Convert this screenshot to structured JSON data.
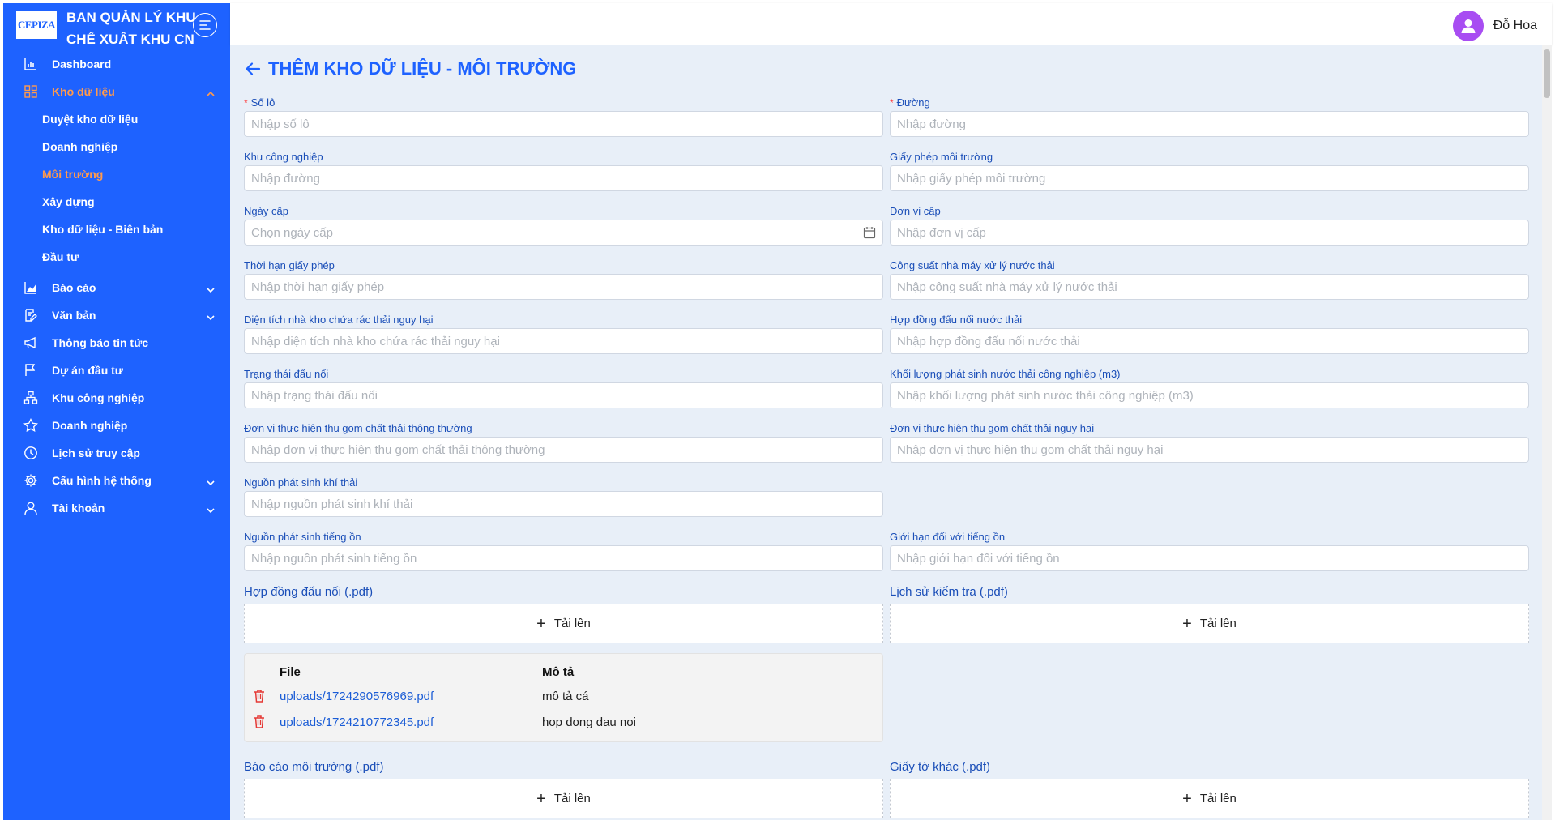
{
  "sidebar": {
    "brand_line1": "BAN QUẢN LÝ KHU",
    "brand_line2": "CHẾ XUẤT KHU CN",
    "logo_text": "CEPIZA",
    "items": [
      {
        "label": "Dashboard",
        "icon": "bar-chart-icon"
      },
      {
        "label": "Kho dữ liệu",
        "icon": "grid-icon",
        "active": true,
        "expanded": true
      },
      {
        "label": "Báo cáo",
        "icon": "line-chart-icon"
      },
      {
        "label": "Văn bản",
        "icon": "document-edit-icon"
      },
      {
        "label": "Thông báo tin tức",
        "icon": "megaphone-icon"
      },
      {
        "label": "Dự án đầu tư",
        "icon": "flag-icon"
      },
      {
        "label": "Khu công nghiệp",
        "icon": "org-chart-icon"
      },
      {
        "label": "Doanh nghiệp",
        "icon": "star-icon"
      },
      {
        "label": "Lịch sử truy cập",
        "icon": "clock-icon"
      },
      {
        "label": "Cấu hình hệ thống",
        "icon": "gear-icon"
      },
      {
        "label": "Tài khoản",
        "icon": "user-icon"
      }
    ],
    "sub_items": [
      {
        "label": "Duyệt kho dữ liệu"
      },
      {
        "label": "Doanh nghiệp"
      },
      {
        "label": "Môi trường",
        "active": true
      },
      {
        "label": "Xây dựng"
      },
      {
        "label": "Kho dữ liệu - Biên bản"
      },
      {
        "label": "Đầu tư"
      }
    ]
  },
  "header": {
    "user_name": "Đỗ Hoa"
  },
  "page": {
    "title": "THÊM KHO DỮ LIỆU - MÔI TRƯỜNG"
  },
  "form": {
    "so_lo": {
      "label": "Số lô",
      "placeholder": "Nhập số lô",
      "required": true
    },
    "duong": {
      "label": "Đường",
      "placeholder": "Nhập đường",
      "required": true
    },
    "khu_cong_nghiep": {
      "label": "Khu công nghiệp",
      "placeholder": "Nhập đường"
    },
    "giay_phep": {
      "label": "Giấy phép môi trường",
      "placeholder": "Nhập giấy phép môi trường"
    },
    "ngay_cap": {
      "label": "Ngày cấp",
      "placeholder": "Chọn ngày cấp"
    },
    "don_vi_cap": {
      "label": "Đơn vị cấp",
      "placeholder": "Nhập đơn vị cấp"
    },
    "thoi_han": {
      "label": "Thời hạn giấy phép",
      "placeholder": "Nhập thời hạn giấy phép"
    },
    "cong_suat": {
      "label": "Công suất nhà máy xử lý nước thải",
      "placeholder": "Nhập công suất nhà máy xử lý nước thải"
    },
    "dien_tich": {
      "label": "Diện tích nhà kho chứa rác thải nguy hại",
      "placeholder": "Nhập diện tích nhà kho chứa rác thải nguy hại"
    },
    "hop_dong_dau_noi": {
      "label": "Hợp đồng đấu nối nước thải",
      "placeholder": "Nhập hợp đồng đấu nối nước thải"
    },
    "trang_thai": {
      "label": "Trạng thái đấu nối",
      "placeholder": "Nhập trạng thái đấu nối"
    },
    "khoi_luong": {
      "label": "Khối lượng phát sinh nước thải công nghiệp (m3)",
      "placeholder": "Nhập khối lượng phát sinh nước thải công nghiệp (m3)"
    },
    "thu_gom_thuong": {
      "label": "Đơn vị thực hiện thu gom chất thải thông thường",
      "placeholder": "Nhập đơn vị thực hiện thu gom chất thải thông thường"
    },
    "thu_gom_nguy_hai": {
      "label": "Đơn vị thực hiện thu gom chất thải nguy hại",
      "placeholder": "Nhập đơn vị thực hiện thu gom chất thải nguy hại"
    },
    "khi_thai": {
      "label": "Nguồn phát sinh khí thải",
      "placeholder": "Nhập nguồn phát sinh khí thải"
    },
    "tieng_on": {
      "label": "Nguồn phát sinh tiếng ồn",
      "placeholder": "Nhập nguồn phát sinh tiếng ồn"
    },
    "gioi_han_on": {
      "label": "Giới hạn đối với tiếng ồn",
      "placeholder": "Nhập giới hạn đối với tiếng ồn"
    }
  },
  "uploads": {
    "button_label": "Tải lên",
    "hop_dong": "Hợp đồng đấu nối (.pdf)",
    "lich_su": "Lịch sử kiểm tra (.pdf)",
    "bao_cao": "Báo cáo môi trường (.pdf)",
    "giay_to_khac": "Giấy tờ khác (.pdf)"
  },
  "file_table": {
    "col_file": "File",
    "col_desc": "Mô tả",
    "rows": [
      {
        "file": "uploads/1724290576969.pdf",
        "desc": "mô tả cá"
      },
      {
        "file": "uploads/1724210772345.pdf",
        "desc": "hop dong dau noi"
      }
    ]
  },
  "colors": {
    "sidebar_bg": "#1e62ff",
    "active_menu": "#ff9a4d",
    "title": "#1e62ff",
    "content_bg": "#e8eff8"
  }
}
